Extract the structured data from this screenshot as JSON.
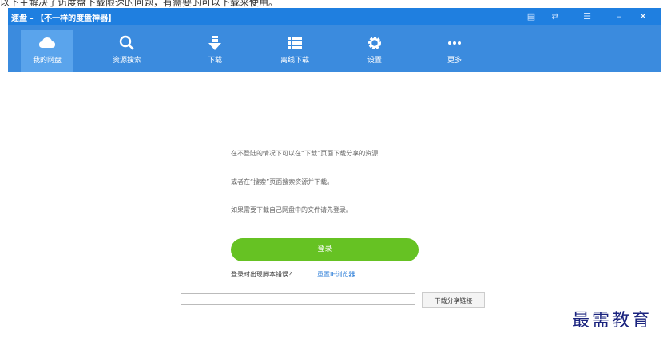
{
  "caption": "以下主解决了访度盘下载限速的问题，有需要的可以下载来使用。",
  "window": {
    "title": "速盘 - 【不一样的度盘神器】",
    "buttons": [
      "feedback-icon",
      "share-icon",
      "menu-icon",
      "minimize-icon",
      "close-icon"
    ]
  },
  "toolbar": {
    "items": [
      {
        "label": "我的网盘",
        "icon": "cloud-icon"
      },
      {
        "label": "资源搜索",
        "icon": "search-icon"
      },
      {
        "label": "下载",
        "icon": "download-icon"
      },
      {
        "label": "离线下载",
        "icon": "list-icon"
      },
      {
        "label": "设置",
        "icon": "gear-icon"
      },
      {
        "label": "更多",
        "icon": "more-icon"
      }
    ]
  },
  "main": {
    "line1": "在不登陆的情况下可以在“下载”页面下载分享的资源",
    "line2": "或者在“搜索”页面搜索资源并下载。",
    "line3": "如果需要下载自己网盘中的文件请先登录。",
    "login_label": "登录",
    "error_text": "登录时出现脚本错误？",
    "reset_label": "重置IE浏览器",
    "share_input_value": "",
    "share_button_label": "下载分享链接"
  },
  "watermark": "最需教育",
  "colors": {
    "titlebar": "#1f7fe0",
    "toolbar": "#3b8bde",
    "login": "#66c223"
  }
}
